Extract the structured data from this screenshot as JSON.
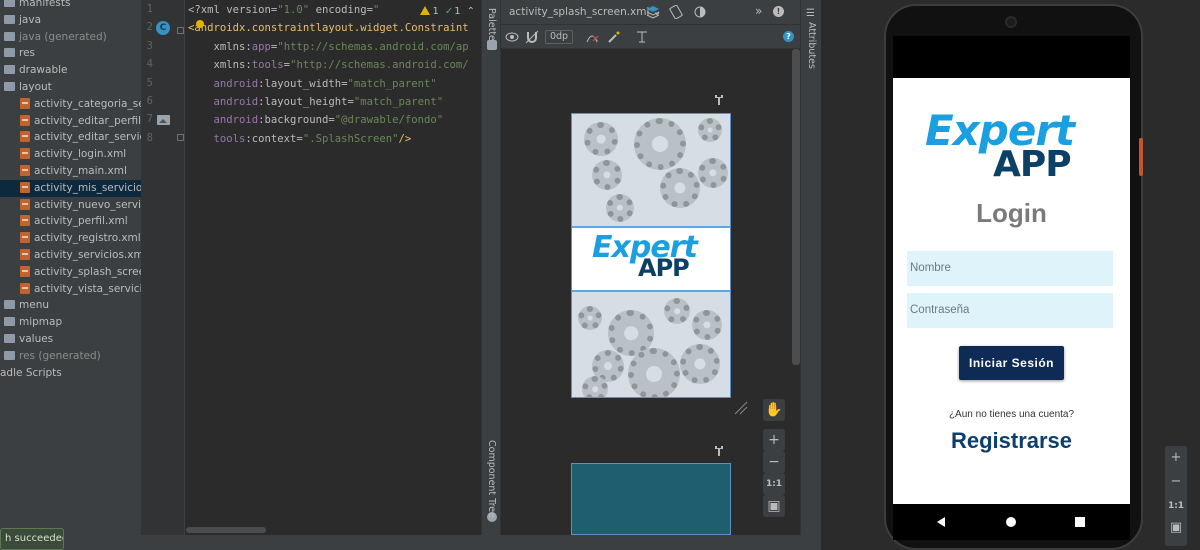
{
  "project_tree": {
    "items": [
      {
        "label": "manifests",
        "indent": 1,
        "kind": "folder",
        "dim": false,
        "selected": false
      },
      {
        "label": "java",
        "indent": 1,
        "kind": "folder",
        "dim": false,
        "selected": false
      },
      {
        "label": "java (generated)",
        "indent": 1,
        "kind": "folder",
        "dim": true,
        "selected": false
      },
      {
        "label": "res",
        "indent": 1,
        "kind": "folder",
        "dim": false,
        "selected": false
      },
      {
        "label": "drawable",
        "indent": 2,
        "kind": "folder",
        "dim": false,
        "selected": false
      },
      {
        "label": "layout",
        "indent": 2,
        "kind": "folder",
        "dim": false,
        "selected": false
      },
      {
        "label": "activity_categoria_servicio",
        "indent": 3,
        "kind": "xml",
        "dim": false,
        "selected": false
      },
      {
        "label": "activity_editar_perfil.xml",
        "indent": 3,
        "kind": "xml",
        "dim": false,
        "selected": false
      },
      {
        "label": "activity_editar_servicio.xml",
        "indent": 3,
        "kind": "xml",
        "dim": false,
        "selected": false
      },
      {
        "label": "activity_login.xml",
        "indent": 3,
        "kind": "xml",
        "dim": false,
        "selected": false
      },
      {
        "label": "activity_main.xml",
        "indent": 3,
        "kind": "xml",
        "dim": false,
        "selected": false
      },
      {
        "label": "activity_mis_servicios.xml",
        "indent": 3,
        "kind": "xml",
        "dim": false,
        "selected": true
      },
      {
        "label": "activity_nuevo_servicio.xml",
        "indent": 3,
        "kind": "xml",
        "dim": false,
        "selected": false
      },
      {
        "label": "activity_perfil.xml",
        "indent": 3,
        "kind": "xml",
        "dim": false,
        "selected": false
      },
      {
        "label": "activity_registro.xml",
        "indent": 3,
        "kind": "xml",
        "dim": false,
        "selected": false
      },
      {
        "label": "activity_servicios.xml",
        "indent": 3,
        "kind": "xml",
        "dim": false,
        "selected": false
      },
      {
        "label": "activity_splash_screen.xml",
        "indent": 3,
        "kind": "xml",
        "dim": false,
        "selected": false
      },
      {
        "label": "activity_vista_servicio.xml",
        "indent": 3,
        "kind": "xml",
        "dim": false,
        "selected": false
      },
      {
        "label": "menu",
        "indent": 2,
        "kind": "folder",
        "dim": false,
        "selected": false
      },
      {
        "label": "mipmap",
        "indent": 2,
        "kind": "folder",
        "dim": false,
        "selected": false
      },
      {
        "label": "values",
        "indent": 2,
        "kind": "folder",
        "dim": false,
        "selected": false
      },
      {
        "label": "res (generated)",
        "indent": 1,
        "kind": "folder",
        "dim": true,
        "selected": false
      },
      {
        "label": "adle Scripts",
        "indent": 0,
        "kind": "none",
        "dim": false,
        "selected": false
      }
    ],
    "build_status": "h succeeded"
  },
  "editor": {
    "line_numbers": [
      "1",
      "2",
      "3",
      "4",
      "5",
      "6",
      "7",
      "8"
    ],
    "warnings": {
      "warning_count": "1",
      "ok_count": "1"
    },
    "lines": [
      [
        {
          "t": "<?xml version=",
          "c": "k-attr"
        },
        {
          "t": "\"1.0\"",
          "c": "k-str"
        },
        {
          "t": " encoding=",
          "c": "k-attr"
        },
        {
          "t": "\"",
          "c": "k-str"
        }
      ],
      [
        {
          "t": "<",
          "c": "k-tag"
        },
        {
          "t": "androidx.constraintlayout.widget.Constraint",
          "c": "k-tag"
        }
      ],
      [
        {
          "t": "    xmlns:",
          "c": "k-attr"
        },
        {
          "t": "app",
          "c": "k-ns"
        },
        {
          "t": "=",
          "c": "k-attr"
        },
        {
          "t": "\"http://schemas.android.com/ap",
          "c": "k-str"
        }
      ],
      [
        {
          "t": "    xmlns:",
          "c": "k-attr"
        },
        {
          "t": "tools",
          "c": "k-ns"
        },
        {
          "t": "=",
          "c": "k-attr"
        },
        {
          "t": "\"http://schemas.android.com/",
          "c": "k-str"
        }
      ],
      [
        {
          "t": "    android",
          "c": "k-ns"
        },
        {
          "t": ":layout_width=",
          "c": "k-attr"
        },
        {
          "t": "\"match_parent\"",
          "c": "k-str"
        }
      ],
      [
        {
          "t": "    android",
          "c": "k-ns"
        },
        {
          "t": ":layout_height=",
          "c": "k-attr"
        },
        {
          "t": "\"match_parent\"",
          "c": "k-str"
        }
      ],
      [
        {
          "t": "    android",
          "c": "k-ns"
        },
        {
          "t": ":background=",
          "c": "k-attr"
        },
        {
          "t": "\"@drawable/fondo\"",
          "c": "k-str"
        }
      ],
      [
        {
          "t": "    tools",
          "c": "k-ns"
        },
        {
          "t": ":context=",
          "c": "k-attr"
        },
        {
          "t": "\".SplashScreen\"",
          "c": "k-str"
        },
        {
          "t": "/>",
          "c": "k-tag"
        }
      ]
    ],
    "gutter_badge": "C"
  },
  "side_tabs": {
    "palette": "Palette",
    "component_tree": "Component Tree",
    "attributes": "Attributes"
  },
  "design_toolbar": {
    "file_name": "activity_splash_screen.xml",
    "margin_value": "0dp",
    "more": "»",
    "help": "?"
  },
  "design_preview": {
    "logo_top": "Expert",
    "logo_bottom": "APP",
    "zoom_buttons": [
      "+",
      "−",
      "1:1"
    ]
  },
  "emulator": {
    "logo_top": "Expert",
    "logo_bottom": "APP",
    "title": "Login",
    "name_placeholder": "Nombre",
    "password_placeholder": "Contraseña",
    "login_button": "Iniciar Sesión",
    "no_account": "¿Aun no tienes una cuenta?",
    "register_link": "Registrarse",
    "zoom_buttons": [
      "+",
      "−",
      "1:1"
    ]
  },
  "colors": {
    "logo_blue": "#1a9fe0",
    "logo_navy": "#0d4066",
    "login_button": "#0d2b55",
    "input_bg": "#dff3fb",
    "selection": "#0d293e"
  }
}
